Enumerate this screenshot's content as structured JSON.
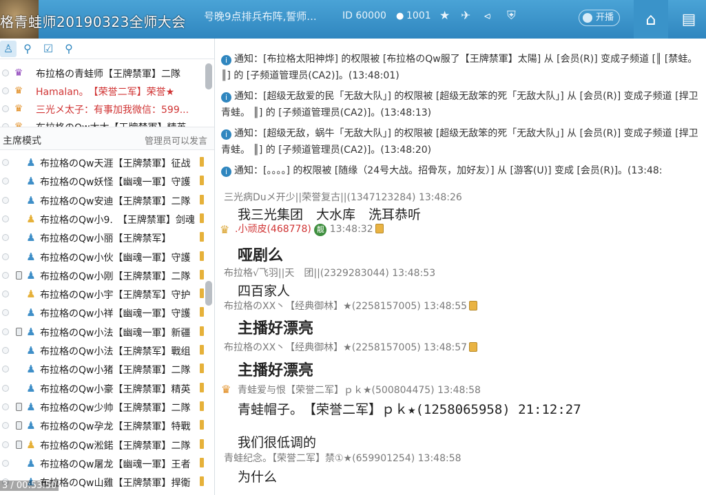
{
  "topbar": {
    "title": "格青蛙师20190323全师大会",
    "notice": "号晚9点排兵布阵,誓师...",
    "room_id": "ID 60000",
    "user_count": "1001",
    "mic_label": "开播",
    "icons": [
      "star-icon",
      "plane-icon",
      "share-icon",
      "shield-icon",
      "home-icon",
      "menu-icon"
    ]
  },
  "left_panel": {
    "tabs": [
      "user-icon",
      "location-icon",
      "checklist-icon",
      "search-icon"
    ],
    "admins": [
      {
        "name": "布拉格の青蛙师【王牌禁軍】二隊",
        "color": "#222222"
      },
      {
        "name": "Hamalan。　【荣誉二军】荣誉★",
        "color": "#d03434"
      },
      {
        "name": "三光メ太子：有事加我微信：599...",
        "color": "#d03434"
      },
      {
        "name": "布拉格のQw太太【王牌禁軍】精英",
        "color": "#222222"
      }
    ],
    "mode_label": "主席模式",
    "mode_note": "管理员可以发言",
    "members": [
      "布拉格のQw天涯【王牌禁軍】征战",
      "布拉格のQw妖怪【幽魂一軍】守護",
      "布拉格のQw安迪【王牌禁軍】二隊",
      "布拉格のQw小9.　【王牌禁軍】剑魂",
      "布拉格のQw小丽【王牌禁军】",
      "布拉格のQw小伙【幽魂一軍】守護",
      "布拉格のQw小刚【王牌禁軍】二隊",
      "布拉格のQw小宇【王牌禁军】守护",
      "布拉格のQw小祥【幽魂一軍】守護",
      "布拉格のQw小法【幽魂一軍】新疆",
      "布拉格のQw小法【王牌禁军】戰组",
      "布拉格のQw小猪【王牌禁軍】二隊",
      "布拉格のQw小豪【王牌禁軍】精英",
      "布拉格のQw少帅【王牌禁軍】二隊",
      "布拉格のQw孕龙【王牌禁軍】特戰",
      "布拉格のQw淞鍩【王牌禁軍】二隊",
      "布拉格のQw屠龙【幽魂一軍】王者",
      "布拉格のQw山雞【王牌禁軍】捍衛"
    ],
    "timecode": "3 / 00:53:50"
  },
  "chat": {
    "notices": [
      {
        "prefix": "通知：",
        "text": "[布拉格太阳神烨] 的权限被 [布拉格のQw服了【王牌禁軍】太陽] 从 [会员(R)] 变成子频道 [║ [禁蛙。 ║] 的 [子频道管理员(CA2)]。(13:48:01)"
      },
      {
        "prefix": "通知：",
        "text": "[超级无敌爱的民「无敌大队」] 的权限被 [超级无敌笨的死「无敌大队」] 从 [会员(R)] 变成子频道 [捍卫青蛙。 ║] 的 [子频道管理员(CA2)]。(13:48:13)"
      },
      {
        "prefix": "通知：",
        "text": "[超级无敌，蜗牛「无敌大队」] 的权限被 [超级无敌笨的死「无敌大队」] 从 [会员(R)] 变成子频道 [捍卫青蛙。 ║] 的 [子频道管理员(CA2)]。(13:48:20)"
      },
      {
        "prefix": "通知：",
        "text": "[。。。。] 的权限被 [随缘（24号大战。招骨灰，加好友）] 从 [游客(U)] 变成 [会员(R)]。(13:48:"
      }
    ],
    "messages": [
      {
        "sender": "三光病Duメ开少||荣誉复古||(1347123284) 13:48:26",
        "body": "我三光集团　大水库　洗耳恭听"
      },
      {
        "sender": ".小顽皮(468778)",
        "time": "13:48:32",
        "badge": "靓",
        "body": "哑剧么"
      },
      {
        "sender": "布拉格√飞羽||天　团||(2329283044) 13:48:53",
        "body": "四百家人"
      },
      {
        "sender": "布拉格のXX丶【经典御林】★(2258157005) 13:48:55",
        "body": "主播好漂亮"
      },
      {
        "sender": "布拉格のXX丶【经典御林】★(2258157005) 13:48:57",
        "body": "主播好漂亮"
      },
      {
        "sender": "青蛙爱与恨【荣誉二军】ｐｋ★(500804475) 13:48:58",
        "body": "青蛙帽子。　【荣誉二军】ｐｋ★(1258065958) 21:12:27",
        "body2": "我们很低调的"
      },
      {
        "sender": "青蛙纪念。【荣誉二军】禁①★(659901254) 13:48:58",
        "body": "为什么"
      }
    ]
  }
}
